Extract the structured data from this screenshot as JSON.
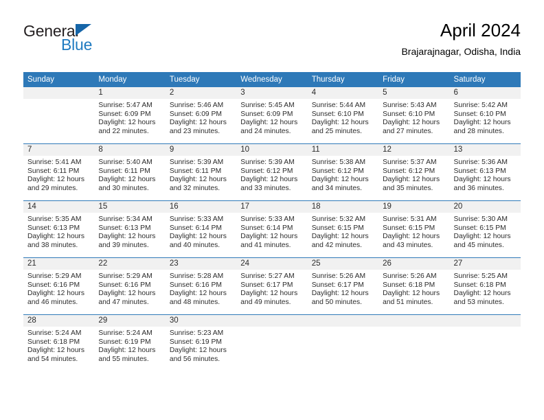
{
  "logo": {
    "line1": "General",
    "line2": "Blue",
    "triangle_color": "#1565a8",
    "blue_color": "#1f7ac0"
  },
  "header": {
    "title": "April 2024",
    "subtitle": "Brajarajnagar, Odisha, India"
  },
  "theme": {
    "header_bg": "#2e79b8",
    "daynum_bg": "#f1f1f1",
    "rule_color": "#2e79b8"
  },
  "weekday_headers": [
    "Sunday",
    "Monday",
    "Tuesday",
    "Wednesday",
    "Thursday",
    "Friday",
    "Saturday"
  ],
  "labels": {
    "sunrise_prefix": "Sunrise:",
    "sunset_prefix": "Sunset:",
    "daylight_prefix": "Daylight:"
  },
  "weeks": [
    [
      {
        "day": "",
        "empty": true
      },
      {
        "day": "1",
        "sunrise": "Sunrise: 5:47 AM",
        "sunset": "Sunset: 6:09 PM",
        "daylight_line1": "Daylight: 12 hours",
        "daylight_line2": "and 22 minutes."
      },
      {
        "day": "2",
        "sunrise": "Sunrise: 5:46 AM",
        "sunset": "Sunset: 6:09 PM",
        "daylight_line1": "Daylight: 12 hours",
        "daylight_line2": "and 23 minutes."
      },
      {
        "day": "3",
        "sunrise": "Sunrise: 5:45 AM",
        "sunset": "Sunset: 6:09 PM",
        "daylight_line1": "Daylight: 12 hours",
        "daylight_line2": "and 24 minutes."
      },
      {
        "day": "4",
        "sunrise": "Sunrise: 5:44 AM",
        "sunset": "Sunset: 6:10 PM",
        "daylight_line1": "Daylight: 12 hours",
        "daylight_line2": "and 25 minutes."
      },
      {
        "day": "5",
        "sunrise": "Sunrise: 5:43 AM",
        "sunset": "Sunset: 6:10 PM",
        "daylight_line1": "Daylight: 12 hours",
        "daylight_line2": "and 27 minutes."
      },
      {
        "day": "6",
        "sunrise": "Sunrise: 5:42 AM",
        "sunset": "Sunset: 6:10 PM",
        "daylight_line1": "Daylight: 12 hours",
        "daylight_line2": "and 28 minutes."
      }
    ],
    [
      {
        "day": "7",
        "sunrise": "Sunrise: 5:41 AM",
        "sunset": "Sunset: 6:11 PM",
        "daylight_line1": "Daylight: 12 hours",
        "daylight_line2": "and 29 minutes."
      },
      {
        "day": "8",
        "sunrise": "Sunrise: 5:40 AM",
        "sunset": "Sunset: 6:11 PM",
        "daylight_line1": "Daylight: 12 hours",
        "daylight_line2": "and 30 minutes."
      },
      {
        "day": "9",
        "sunrise": "Sunrise: 5:39 AM",
        "sunset": "Sunset: 6:11 PM",
        "daylight_line1": "Daylight: 12 hours",
        "daylight_line2": "and 32 minutes."
      },
      {
        "day": "10",
        "sunrise": "Sunrise: 5:39 AM",
        "sunset": "Sunset: 6:12 PM",
        "daylight_line1": "Daylight: 12 hours",
        "daylight_line2": "and 33 minutes."
      },
      {
        "day": "11",
        "sunrise": "Sunrise: 5:38 AM",
        "sunset": "Sunset: 6:12 PM",
        "daylight_line1": "Daylight: 12 hours",
        "daylight_line2": "and 34 minutes."
      },
      {
        "day": "12",
        "sunrise": "Sunrise: 5:37 AM",
        "sunset": "Sunset: 6:12 PM",
        "daylight_line1": "Daylight: 12 hours",
        "daylight_line2": "and 35 minutes."
      },
      {
        "day": "13",
        "sunrise": "Sunrise: 5:36 AM",
        "sunset": "Sunset: 6:13 PM",
        "daylight_line1": "Daylight: 12 hours",
        "daylight_line2": "and 36 minutes."
      }
    ],
    [
      {
        "day": "14",
        "sunrise": "Sunrise: 5:35 AM",
        "sunset": "Sunset: 6:13 PM",
        "daylight_line1": "Daylight: 12 hours",
        "daylight_line2": "and 38 minutes."
      },
      {
        "day": "15",
        "sunrise": "Sunrise: 5:34 AM",
        "sunset": "Sunset: 6:13 PM",
        "daylight_line1": "Daylight: 12 hours",
        "daylight_line2": "and 39 minutes."
      },
      {
        "day": "16",
        "sunrise": "Sunrise: 5:33 AM",
        "sunset": "Sunset: 6:14 PM",
        "daylight_line1": "Daylight: 12 hours",
        "daylight_line2": "and 40 minutes."
      },
      {
        "day": "17",
        "sunrise": "Sunrise: 5:33 AM",
        "sunset": "Sunset: 6:14 PM",
        "daylight_line1": "Daylight: 12 hours",
        "daylight_line2": "and 41 minutes."
      },
      {
        "day": "18",
        "sunrise": "Sunrise: 5:32 AM",
        "sunset": "Sunset: 6:15 PM",
        "daylight_line1": "Daylight: 12 hours",
        "daylight_line2": "and 42 minutes."
      },
      {
        "day": "19",
        "sunrise": "Sunrise: 5:31 AM",
        "sunset": "Sunset: 6:15 PM",
        "daylight_line1": "Daylight: 12 hours",
        "daylight_line2": "and 43 minutes."
      },
      {
        "day": "20",
        "sunrise": "Sunrise: 5:30 AM",
        "sunset": "Sunset: 6:15 PM",
        "daylight_line1": "Daylight: 12 hours",
        "daylight_line2": "and 45 minutes."
      }
    ],
    [
      {
        "day": "21",
        "sunrise": "Sunrise: 5:29 AM",
        "sunset": "Sunset: 6:16 PM",
        "daylight_line1": "Daylight: 12 hours",
        "daylight_line2": "and 46 minutes."
      },
      {
        "day": "22",
        "sunrise": "Sunrise: 5:29 AM",
        "sunset": "Sunset: 6:16 PM",
        "daylight_line1": "Daylight: 12 hours",
        "daylight_line2": "and 47 minutes."
      },
      {
        "day": "23",
        "sunrise": "Sunrise: 5:28 AM",
        "sunset": "Sunset: 6:16 PM",
        "daylight_line1": "Daylight: 12 hours",
        "daylight_line2": "and 48 minutes."
      },
      {
        "day": "24",
        "sunrise": "Sunrise: 5:27 AM",
        "sunset": "Sunset: 6:17 PM",
        "daylight_line1": "Daylight: 12 hours",
        "daylight_line2": "and 49 minutes."
      },
      {
        "day": "25",
        "sunrise": "Sunrise: 5:26 AM",
        "sunset": "Sunset: 6:17 PM",
        "daylight_line1": "Daylight: 12 hours",
        "daylight_line2": "and 50 minutes."
      },
      {
        "day": "26",
        "sunrise": "Sunrise: 5:26 AM",
        "sunset": "Sunset: 6:18 PM",
        "daylight_line1": "Daylight: 12 hours",
        "daylight_line2": "and 51 minutes."
      },
      {
        "day": "27",
        "sunrise": "Sunrise: 5:25 AM",
        "sunset": "Sunset: 6:18 PM",
        "daylight_line1": "Daylight: 12 hours",
        "daylight_line2": "and 53 minutes."
      }
    ],
    [
      {
        "day": "28",
        "sunrise": "Sunrise: 5:24 AM",
        "sunset": "Sunset: 6:18 PM",
        "daylight_line1": "Daylight: 12 hours",
        "daylight_line2": "and 54 minutes."
      },
      {
        "day": "29",
        "sunrise": "Sunrise: 5:24 AM",
        "sunset": "Sunset: 6:19 PM",
        "daylight_line1": "Daylight: 12 hours",
        "daylight_line2": "and 55 minutes."
      },
      {
        "day": "30",
        "sunrise": "Sunrise: 5:23 AM",
        "sunset": "Sunset: 6:19 PM",
        "daylight_line1": "Daylight: 12 hours",
        "daylight_line2": "and 56 minutes."
      },
      {
        "day": "",
        "empty": true
      },
      {
        "day": "",
        "empty": true
      },
      {
        "day": "",
        "empty": true
      },
      {
        "day": "",
        "empty": true
      }
    ]
  ]
}
